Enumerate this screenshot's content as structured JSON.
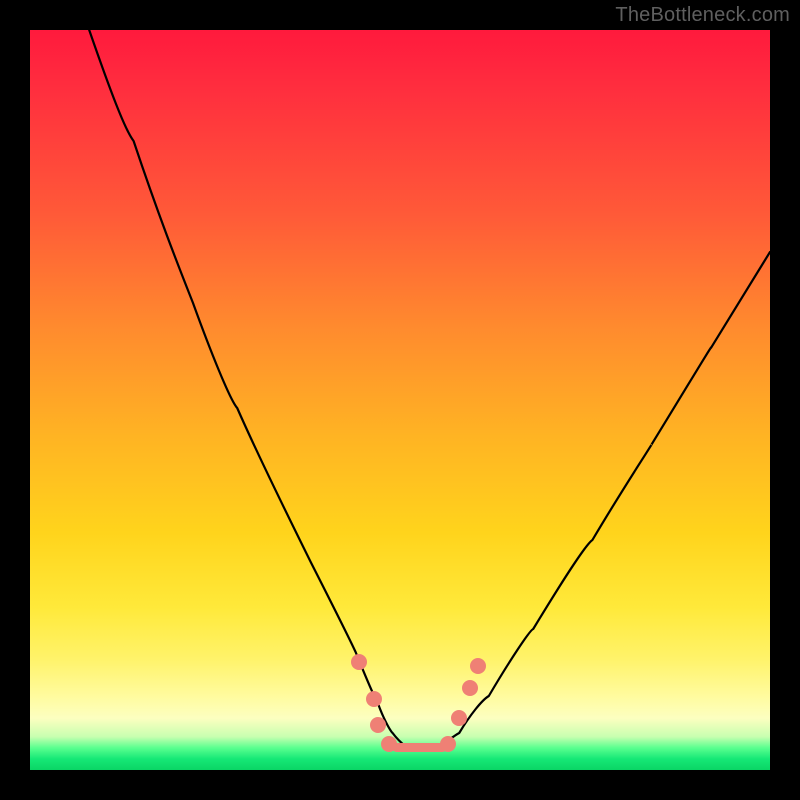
{
  "watermark_text": "TheBottleneck.com",
  "colors": {
    "background_frame": "#000000",
    "gradient_top": "#ff1a3d",
    "gradient_mid": "#ffd41c",
    "gradient_bottom": "#0ad565",
    "curve": "#000000",
    "marker": "#ef8075"
  },
  "chart_data": {
    "type": "line",
    "title": "",
    "xlabel": "",
    "ylabel": "",
    "xlim": [
      0,
      100
    ],
    "ylim": [
      0,
      100
    ],
    "grid": false,
    "legend": false,
    "series": [
      {
        "name": "bottleneck-curve",
        "x": [
          8,
          14,
          20,
          26,
          32,
          38,
          44,
          47,
          49,
          51,
          53,
          55,
          58,
          62,
          68,
          76,
          84,
          92,
          100
        ],
        "y": [
          100,
          85,
          70,
          55,
          41,
          28,
          16,
          9,
          5,
          3,
          3,
          3,
          5,
          10,
          19,
          31,
          44,
          57,
          70
        ]
      }
    ],
    "markers": [
      {
        "x": 44.5,
        "y": 14.5
      },
      {
        "x": 46.5,
        "y": 9.5
      },
      {
        "x": 47.0,
        "y": 6.0
      },
      {
        "x": 48.5,
        "y": 3.5
      },
      {
        "x": 56.5,
        "y": 3.5
      },
      {
        "x": 58.0,
        "y": 7.0
      },
      {
        "x": 59.5,
        "y": 11.0
      },
      {
        "x": 60.5,
        "y": 14.0
      }
    ],
    "flat_segment": {
      "x_start": 49,
      "x_end": 56,
      "y": 2.6
    },
    "notes": "Axes unlabeled; values are relative estimates in 0–100 space inferred from curve geometry and marker positions. y increases upward (100 = top of gradient area)."
  }
}
